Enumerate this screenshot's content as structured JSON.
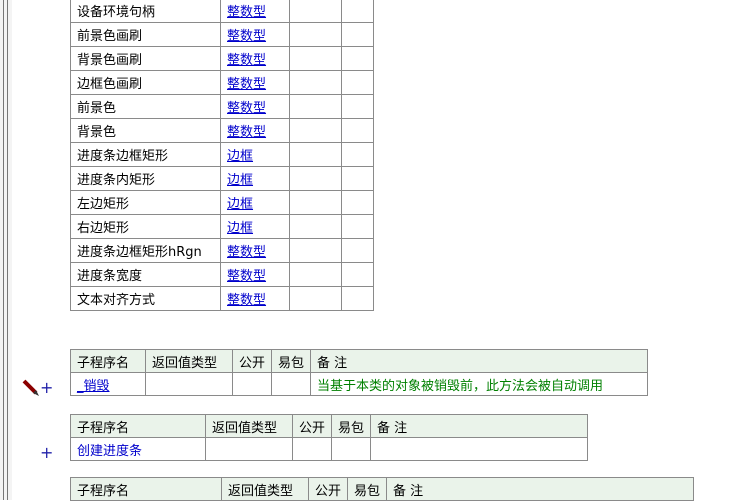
{
  "variables": [
    {
      "name": "设备环境句柄",
      "type": "整数型"
    },
    {
      "name": "前景色画刷",
      "type": "整数型"
    },
    {
      "name": "背景色画刷",
      "type": "整数型"
    },
    {
      "name": "边框色画刷",
      "type": "整数型"
    },
    {
      "name": "前景色",
      "type": "整数型"
    },
    {
      "name": "背景色",
      "type": "整数型"
    },
    {
      "name": "进度条边框矩形",
      "type": "边框"
    },
    {
      "name": "进度条内矩形",
      "type": "边框"
    },
    {
      "name": "左边矩形",
      "type": "边框"
    },
    {
      "name": "右边矩形",
      "type": "边框"
    },
    {
      "name": "进度条边框矩形hRgn",
      "type": "整数型"
    },
    {
      "name": "进度条宽度",
      "type": "整数型"
    },
    {
      "name": "文本对齐方式",
      "type": "整数型"
    }
  ],
  "subroutine_header": {
    "name": "子程序名",
    "return_type": "返回值类型",
    "public": "公开",
    "easy_pack": "易包",
    "note": "备 注"
  },
  "subroutines": [
    {
      "name": "_销毁",
      "note": "当基于本类的对象被销毁前，此方法会被自动调用",
      "expand": "+"
    },
    {
      "name": "创建进度条",
      "note": "",
      "expand": "+"
    }
  ],
  "colors": {
    "link": "#0000cc",
    "comment": "#008000",
    "header_bg": "#eaf3ea"
  }
}
